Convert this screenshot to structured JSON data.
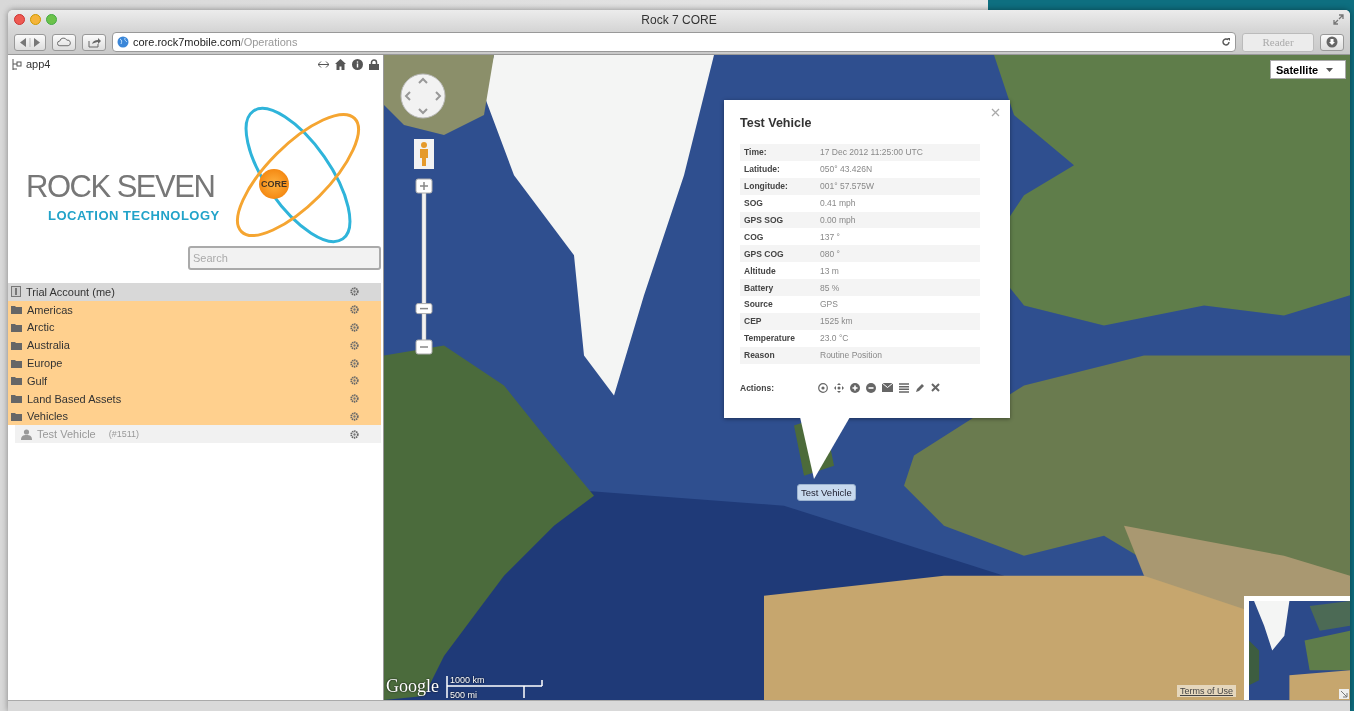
{
  "window": {
    "title": "Rock 7 CORE",
    "url_host": "core.rock7mobile.com",
    "url_path": "/Operations",
    "reader_label": "Reader"
  },
  "sidebar": {
    "app_label": "app4",
    "logo": {
      "name": "ROCK SEVEN",
      "tagline": "LOCATION TECHNOLOGY",
      "badge": "CORE"
    },
    "search": {
      "placeholder": "Search"
    },
    "tree": [
      {
        "kind": "account",
        "label": "Trial Account (me)"
      },
      {
        "kind": "folder",
        "label": "Americas"
      },
      {
        "kind": "folder",
        "label": "Arctic"
      },
      {
        "kind": "folder",
        "label": "Australia"
      },
      {
        "kind": "folder",
        "label": "Europe"
      },
      {
        "kind": "folder",
        "label": "Gulf"
      },
      {
        "kind": "folder",
        "label": "Land Based Assets"
      },
      {
        "kind": "folder",
        "label": "Vehicles",
        "children": [
          {
            "kind": "vehicle",
            "label": "Test Vehicle",
            "ref": "(#1511)"
          }
        ]
      }
    ]
  },
  "map": {
    "map_type": "Satellite",
    "zoom": {
      "level": 0.21
    },
    "marker": {
      "label": "Test Vehicle"
    },
    "popup": {
      "title": "Test Vehicle",
      "fields": [
        {
          "label": "Time:",
          "value": "17 Dec 2012 11:25:00 UTC"
        },
        {
          "label": "Latitude:",
          "value": "050° 43.426N"
        },
        {
          "label": "Longitude:",
          "value": "001° 57.575W"
        },
        {
          "label": "SOG",
          "value": "0.41 mph"
        },
        {
          "label": "GPS SOG",
          "value": "0.00 mph"
        },
        {
          "label": "COG",
          "value": "137 °"
        },
        {
          "label": "GPS COG",
          "value": "080 °"
        },
        {
          "label": "Altitude",
          "value": "13 m"
        },
        {
          "label": "Battery",
          "value": "85 %"
        },
        {
          "label": "Source",
          "value": "GPS"
        },
        {
          "label": "CEP",
          "value": "1525 km"
        },
        {
          "label": "Temperature",
          "value": "23.0 °C"
        },
        {
          "label": "Reason",
          "value": "Routine Position"
        }
      ],
      "actions_label": "Actions:"
    },
    "google_logo": "Google",
    "scale": {
      "metric": "1000 km",
      "imperial": "500 mi"
    },
    "terms": "Terms of Use"
  }
}
